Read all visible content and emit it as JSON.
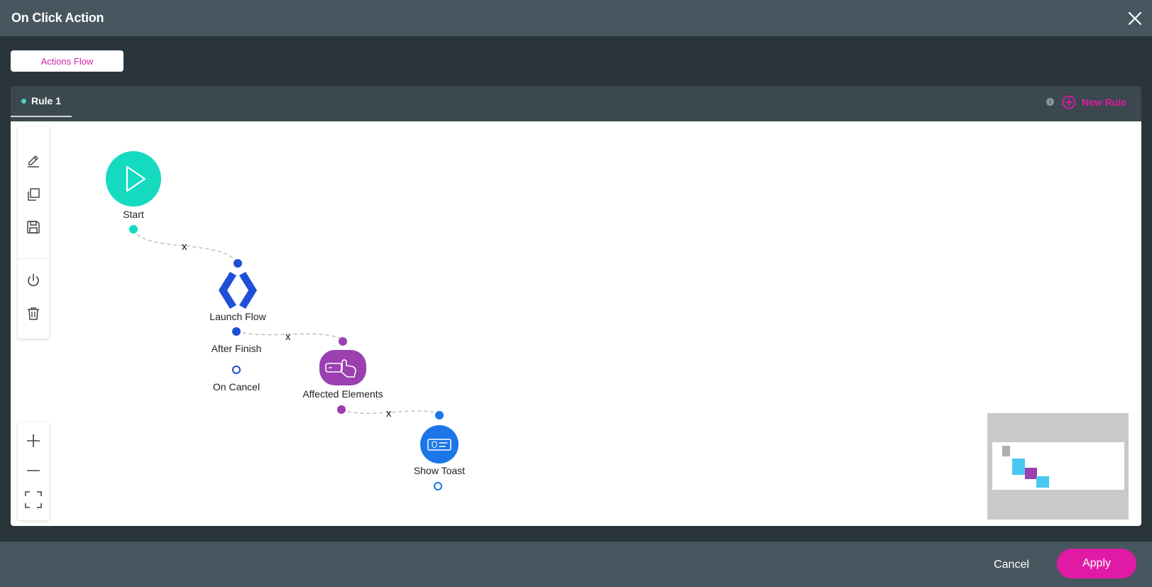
{
  "window": {
    "title": "On Click Action"
  },
  "tabs": {
    "actions_flow": "Actions Flow"
  },
  "rule": {
    "name": "Rule 1",
    "info_glyph": "i",
    "new_rule_label": "New Rule"
  },
  "toolbar": {
    "tools": [
      "edit-icon",
      "copy-icon",
      "save-icon",
      "power-icon",
      "trash-icon"
    ],
    "zoom": [
      "zoom-in-icon",
      "zoom-out-icon",
      "fit-screen-icon"
    ]
  },
  "flow": {
    "nodes": {
      "start": "Start",
      "launch_flow": "Launch Flow",
      "after_finish": "After Finish",
      "on_cancel": "On Cancel",
      "affected_elements": "Affected Elements",
      "show_toast": "Show Toast"
    },
    "edge_marker": "x"
  },
  "footer": {
    "cancel": "Cancel",
    "apply": "Apply"
  },
  "colors": {
    "accent": "#e01aa4",
    "start": "#14dbc0",
    "launch_flow": "#1f4fd6",
    "affected_elements": "#9b3fb1",
    "show_toast": "#1c76e8"
  }
}
